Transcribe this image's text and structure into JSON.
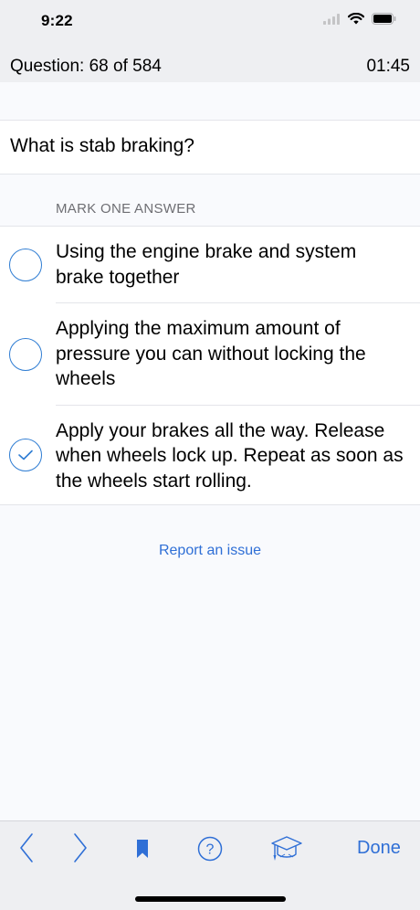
{
  "status_bar": {
    "time": "9:22"
  },
  "header": {
    "counter": "Question: 68 of 584",
    "timer": "01:45"
  },
  "question": {
    "text": "What is stab braking?"
  },
  "answers_section": {
    "label": "MARK ONE ANSWER",
    "answers": [
      {
        "text": "Using the engine brake and system brake together",
        "selected": false
      },
      {
        "text": "Applying the maximum amount of pressure you can without locking the wheels",
        "selected": false
      },
      {
        "text": "Apply your brakes all the way. Release when wheels lock up. Repeat as soon as the wheels start rolling.",
        "selected": true
      }
    ]
  },
  "report_link": "Report an issue",
  "toolbar": {
    "icons": [
      "chevron-left-icon",
      "chevron-right-icon",
      "bookmark-icon",
      "help-icon",
      "graduation-cap-icon"
    ],
    "done_label": "Done"
  },
  "colors": {
    "accent": "#2f6fd6",
    "radio": "#2f7dd3",
    "bar_bg": "#eeeff2"
  }
}
